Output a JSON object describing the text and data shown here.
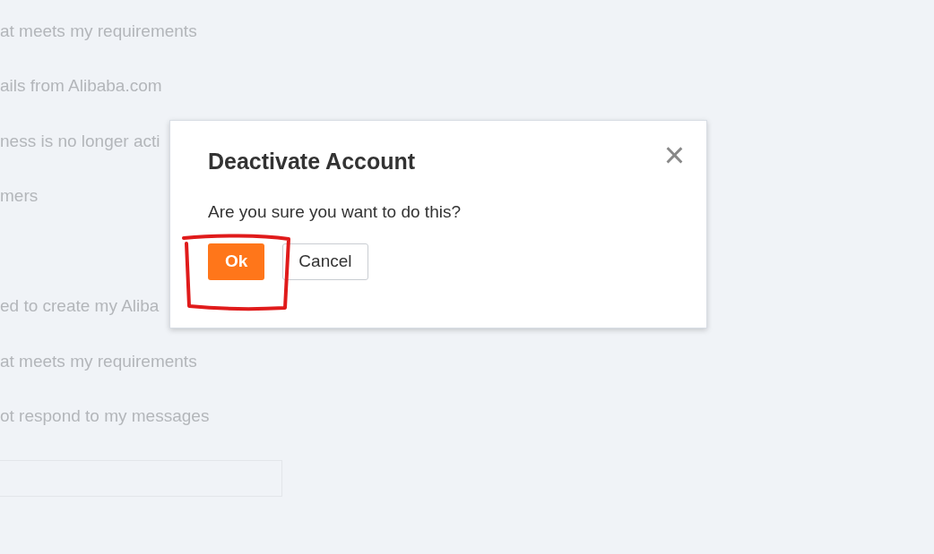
{
  "background_text_groups": [
    [
      "at meets my requirements",
      "ails from Alibaba.com",
      "ness is no longer acti",
      "mers"
    ],
    [
      "ed to create my Aliba",
      "at meets my requirements",
      "ot respond to my messages"
    ]
  ],
  "dialog": {
    "title": "Deactivate Account",
    "close_glyph": "×",
    "message": "Are you sure you want to do this?",
    "buttons": [
      {
        "kind": "primary",
        "label": "Ok"
      },
      {
        "kind": "secondary",
        "label": "Cancel"
      }
    ]
  }
}
